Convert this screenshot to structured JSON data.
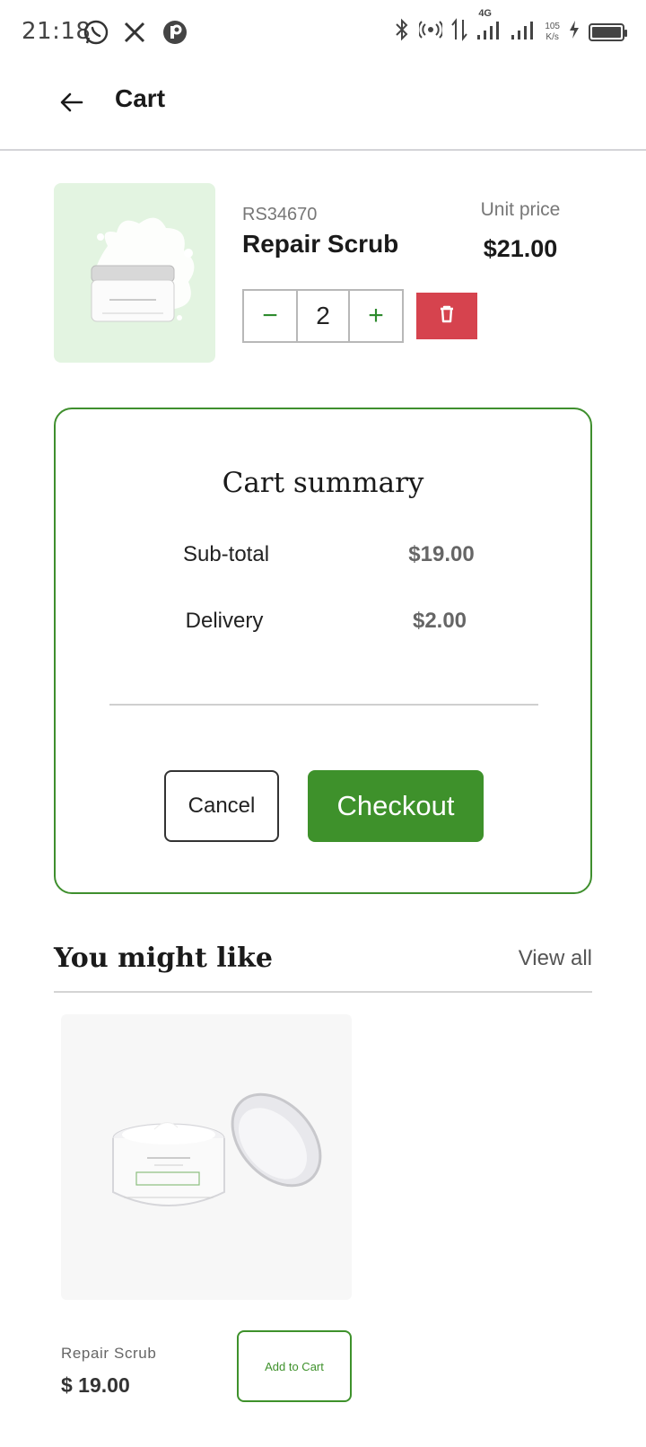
{
  "status_bar": {
    "time": "21:18",
    "left_icons": [
      "whatsapp-icon",
      "x-icon",
      "app-p-icon"
    ],
    "right_icons": [
      "bluetooth-icon",
      "hotspot-icon",
      "data-arrows-icon",
      "signal-4g-icon",
      "signal-icon",
      "charging-icon",
      "battery-icon"
    ],
    "network_type": "4G",
    "speed_value": "105",
    "speed_unit": "K/s"
  },
  "header": {
    "title": "Cart",
    "back_icon": "arrow-left-icon"
  },
  "cart_item": {
    "sku": "RS34670",
    "name": "Repair Scrub",
    "unit_price_label": "Unit price",
    "unit_price": "$21.00",
    "quantity": "2",
    "minus_label": "−",
    "plus_label": "+",
    "delete_icon": "trash-icon",
    "image_bg": "#e3f4e1"
  },
  "summary": {
    "title": "Cart summary",
    "subtotal_label": "Sub-total",
    "subtotal_value": "$19.00",
    "delivery_label": "Delivery",
    "delivery_value": "$2.00",
    "cancel_label": "Cancel",
    "checkout_label": "Checkout"
  },
  "recommendations": {
    "title": "You might like",
    "view_all_label": "View all",
    "items": [
      {
        "name": "Repair Scrub",
        "price": "$ 19.00",
        "add_label": "Add to Cart"
      }
    ]
  },
  "colors": {
    "accent_green": "#3e912b",
    "delete_red": "#d6434e",
    "border_gray": "#b8b8b8"
  }
}
